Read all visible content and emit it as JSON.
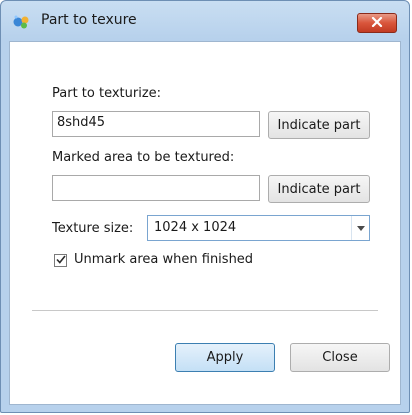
{
  "window": {
    "title": "Part to texure",
    "title_icon": "texture-tool-icon",
    "close_icon": "close-icon"
  },
  "form": {
    "part_label": "Part to texturize:",
    "part_value": "8shd45",
    "indicate_part_label": "Indicate part",
    "marked_area_label": "Marked area to be textured:",
    "marked_area_value": "",
    "indicate_area_label": "Indicate part",
    "texture_size_label": "Texture size:",
    "texture_size_value": "1024 x 1024",
    "unmark_label": "Unmark area when finished",
    "unmark_checked": true
  },
  "footer": {
    "apply_label": "Apply",
    "close_label": "Close"
  },
  "colors": {
    "frame": "#b7d1ec",
    "close_button": "#d9553b",
    "primary_button": "#c4e0f6"
  }
}
